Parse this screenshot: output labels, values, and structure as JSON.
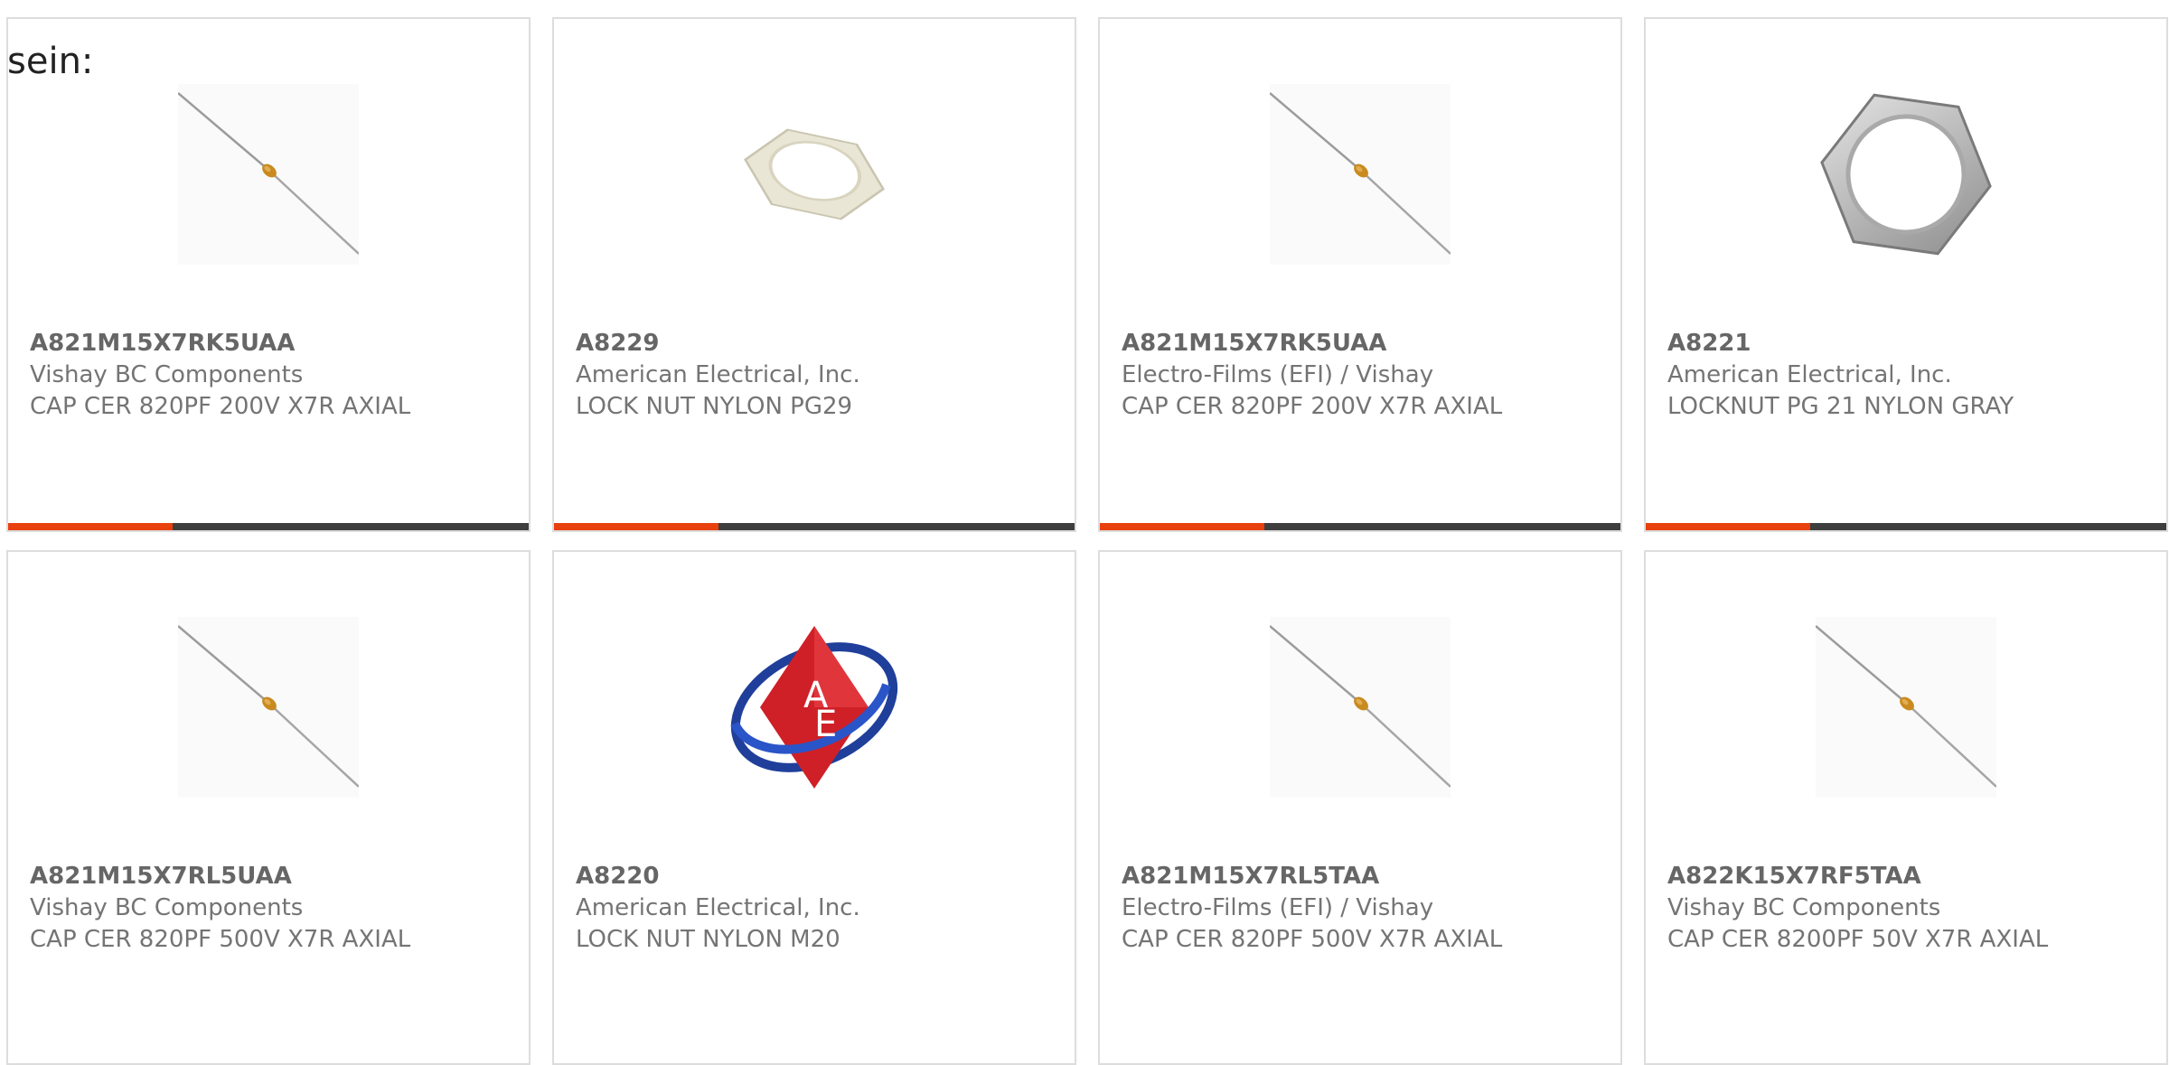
{
  "intro_text": "sein:",
  "colors": {
    "accent": "#e8400f",
    "bar_dark": "#3e3e3e",
    "text": "#747474",
    "card_border": "#dddddd"
  },
  "products": [
    {
      "part": "A821M15X7RK5UAA",
      "maker": "Vishay BC Components",
      "desc": "CAP CER 820PF 200V X7R AXIAL",
      "image": "axial-capacitor-image"
    },
    {
      "part": "A8229",
      "maker": "American Electrical, Inc.",
      "desc": "LOCK NUT NYLON PG29",
      "image": "white-nylon-lock-nut-image"
    },
    {
      "part": "A821M15X7RK5UAA",
      "maker": "Electro-Films (EFI) / Vishay",
      "desc": "CAP CER 820PF 200V X7R AXIAL",
      "image": "axial-capacitor-image"
    },
    {
      "part": "A8221",
      "maker": "American Electrical, Inc.",
      "desc": "LOCKNUT PG 21 NYLON GRAY",
      "image": "gray-nylon-lock-nut-image"
    },
    {
      "part": "A821M15X7RL5UAA",
      "maker": "Vishay BC Components",
      "desc": "CAP CER 820PF 500V X7R AXIAL",
      "image": "axial-capacitor-image"
    },
    {
      "part": "A8220",
      "maker": "American Electrical, Inc.",
      "desc": "LOCK NUT NYLON M20",
      "image": "american-electrical-logo-image"
    },
    {
      "part": "A821M15X7RL5TAA",
      "maker": "Electro-Films (EFI) / Vishay",
      "desc": "CAP CER 820PF 500V X7R AXIAL",
      "image": "axial-capacitor-image"
    },
    {
      "part": "A822K15X7RF5TAA",
      "maker": "Vishay BC Components",
      "desc": "CAP CER 8200PF 50V X7R AXIAL",
      "image": "axial-capacitor-image"
    }
  ]
}
